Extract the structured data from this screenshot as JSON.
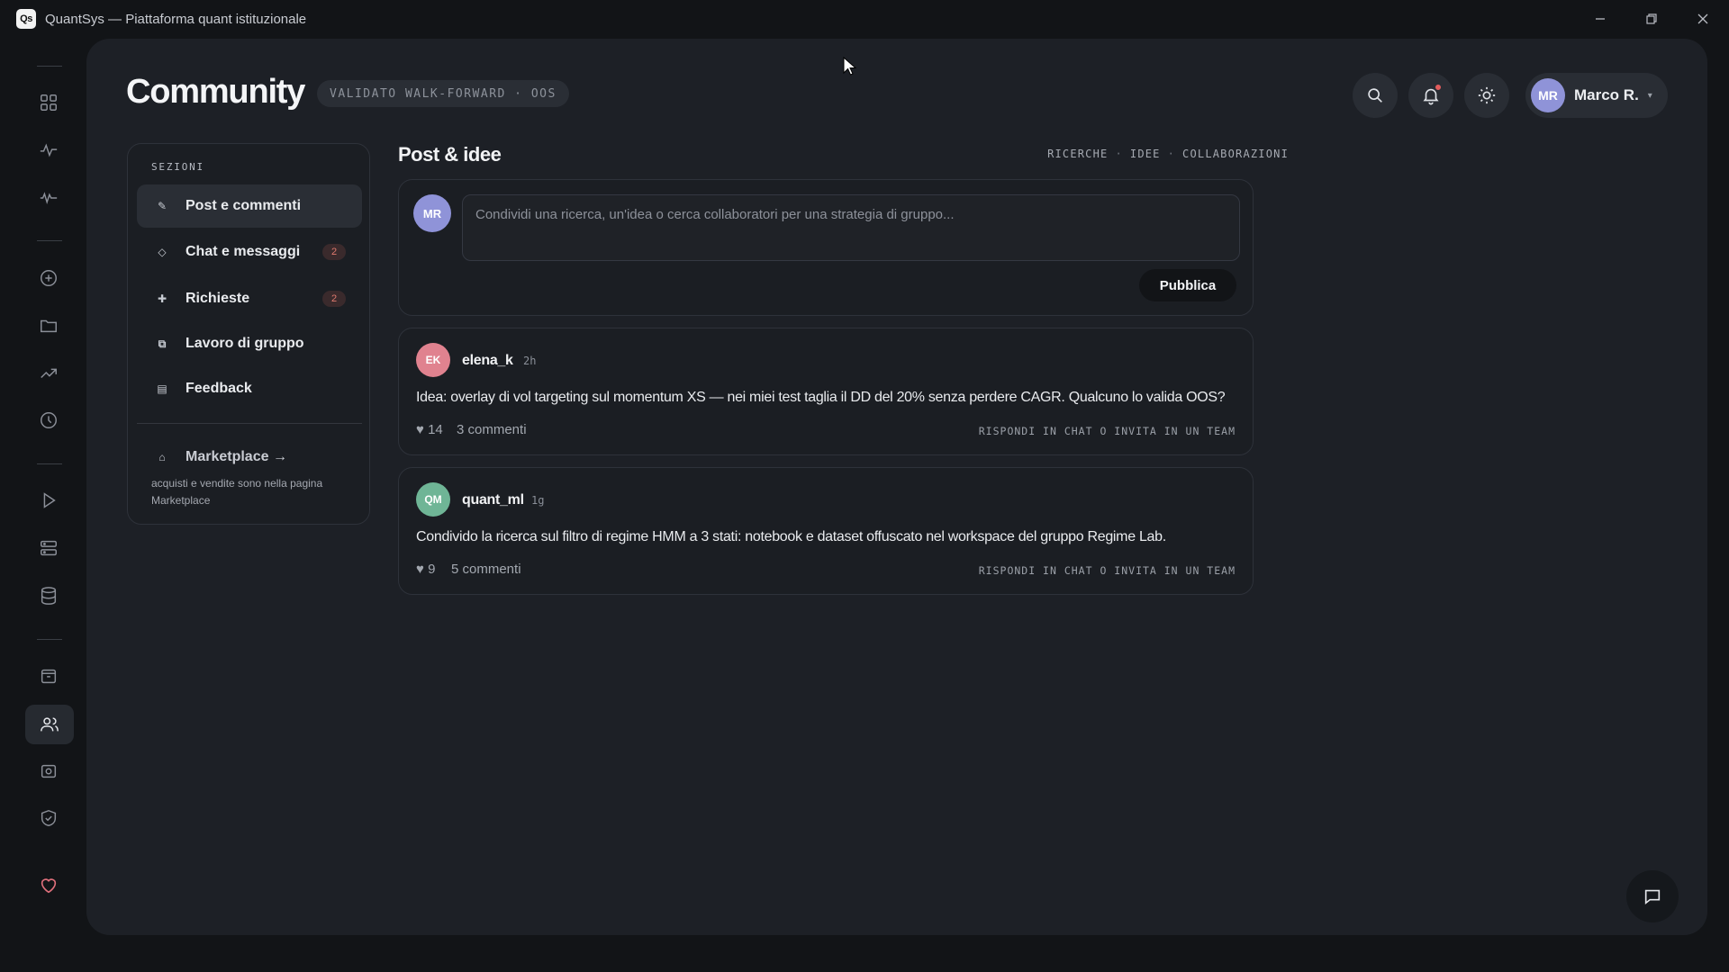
{
  "window": {
    "logo_text": "Qs",
    "title": "QuantSys — Piattaforma quant istituzionale"
  },
  "rail": {
    "icons": [
      "dashboard-icon",
      "pulse-icon",
      "activity-icon",
      "add-circle-icon",
      "folder-icon",
      "trending-up-icon",
      "clock-icon",
      "play-icon",
      "server-icon",
      "database-icon",
      "archive-icon",
      "users-icon",
      "camera-icon",
      "shield-check-icon",
      "heart-icon"
    ],
    "active": "users-icon"
  },
  "header": {
    "title": "Community",
    "badge": "VALIDATO WALK-FORWARD · OOS"
  },
  "user": {
    "initials": "MR",
    "name": "Marco R."
  },
  "sections": {
    "heading": "SEZIONI",
    "items": [
      {
        "icon": "pencil-icon",
        "glyph": "✎",
        "label": "Post e commenti",
        "badge": "",
        "active": true
      },
      {
        "icon": "diamond-icon",
        "glyph": "◇",
        "label": "Chat e messaggi",
        "badge": "2",
        "active": false
      },
      {
        "icon": "plus-icon",
        "glyph": "✚",
        "label": "Richieste",
        "badge": "2",
        "active": false
      },
      {
        "icon": "group-work-icon",
        "glyph": "⧉",
        "label": "Lavoro di gruppo",
        "badge": "",
        "active": false
      },
      {
        "icon": "feedback-icon",
        "glyph": "▤",
        "label": "Feedback",
        "badge": "",
        "active": false
      }
    ],
    "marketplace": {
      "glyph": "⌂",
      "label": "Marketplace →",
      "note": "acquisti e vendite sono nella pagina Marketplace"
    }
  },
  "feed": {
    "title": "Post & idee",
    "tabs": [
      "RICERCHE",
      "IDEE",
      "COLLABORAZIONI"
    ],
    "composer": {
      "initials": "MR",
      "placeholder": "Condividi una ricerca, un'idea o cerca collaboratori per una strategia di gruppo...",
      "publish_label": "Pubblica"
    },
    "posts": [
      {
        "initials": "EK",
        "avatar_color": "#e0828f",
        "user": "elena_k",
        "time": "2h",
        "body": "Idea: overlay di vol targeting sul momentum XS — nei miei test taglia il DD del 20% senza perdere CAGR. Qualcuno lo valida OOS?",
        "likes": "♥ 14",
        "comments": "3 commenti",
        "action": "RISPONDI IN CHAT O INVITA IN UN TEAM"
      },
      {
        "initials": "QM",
        "avatar_color": "#6fb596",
        "user": "quant_ml",
        "time": "1g",
        "body": "Condivido la ricerca sul filtro di regime HMM a 3 stati: notebook e dataset offuscato nel workspace del gruppo Regime Lab.",
        "likes": "♥ 9",
        "comments": "5 commenti",
        "action": "RISPONDI IN CHAT O INVITA IN UN TEAM"
      }
    ]
  },
  "colors": {
    "background": "#121417",
    "panel": "#1d2026",
    "card": "#1b1e23",
    "badge_red": "#e07a6f",
    "avatar_user": "#8f93d8"
  }
}
